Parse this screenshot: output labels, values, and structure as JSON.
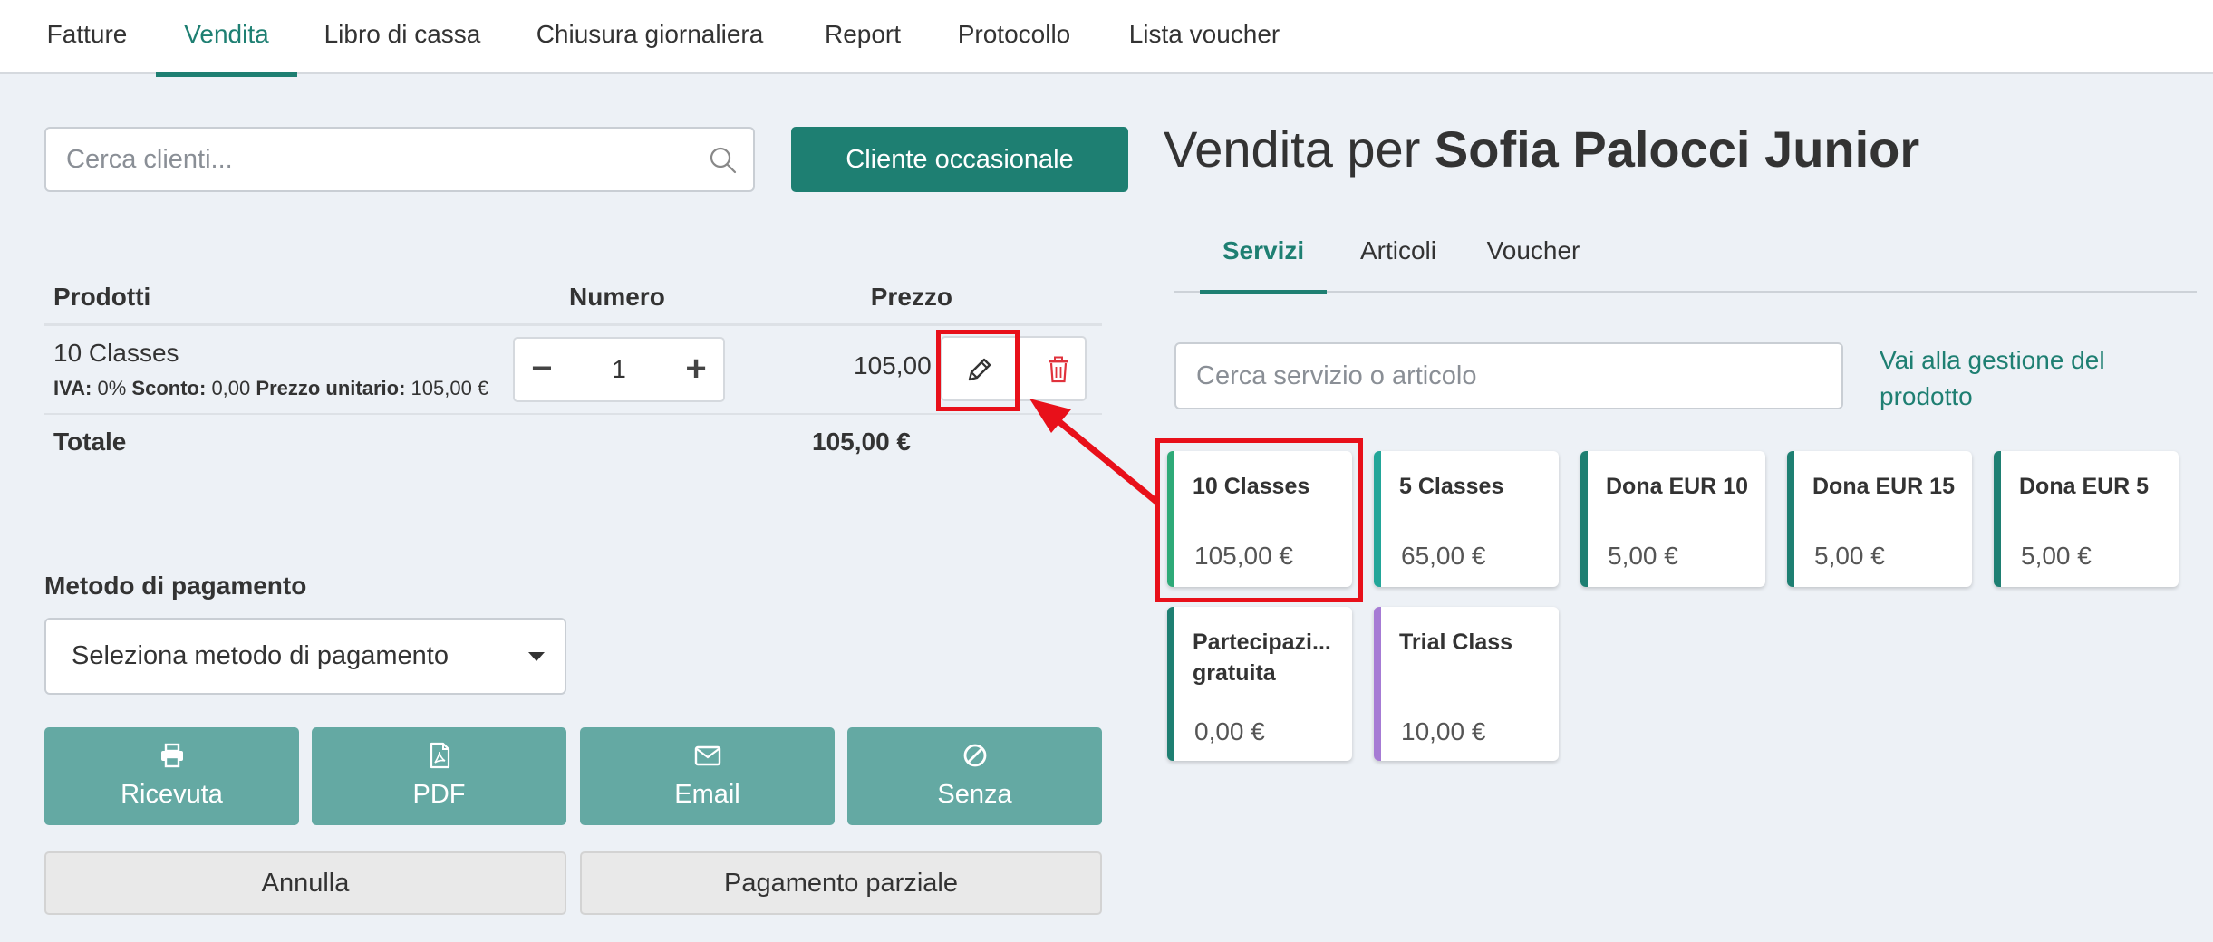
{
  "topnav": {
    "tabs": [
      {
        "label": "Fatture"
      },
      {
        "label": "Vendita"
      },
      {
        "label": "Libro di cassa"
      },
      {
        "label": "Chiusura giornaliera"
      },
      {
        "label": "Report"
      },
      {
        "label": "Protocollo"
      },
      {
        "label": "Lista voucher"
      }
    ],
    "active": "Vendita"
  },
  "client_search": {
    "placeholder": "Cerca clienti..."
  },
  "occasional_client_button": "Cliente occasionale",
  "products_table": {
    "headers": {
      "products": "Prodotti",
      "number": "Numero",
      "price": "Prezzo"
    },
    "rows": [
      {
        "name": "10 Classes",
        "vat_label": "IVA:",
        "vat": "0%",
        "discount_label": "Sconto:",
        "discount": "0,00",
        "unit_price_label": "Prezzo unitario:",
        "unit_price": "105,00 €",
        "quantity": "1",
        "price": "105,00 €"
      }
    ],
    "total_label": "Totale",
    "total_value": "105,00 €"
  },
  "payment": {
    "label": "Metodo di pagamento",
    "selected": "Seleziona metodo di pagamento",
    "actions": [
      {
        "label": "Ricevuta",
        "icon": "printer-icon"
      },
      {
        "label": "PDF",
        "icon": "pdf-file-icon"
      },
      {
        "label": "Email",
        "icon": "envelope-icon"
      },
      {
        "label": "Senza",
        "icon": "ban-icon"
      }
    ],
    "cancel": "Annulla",
    "partial": "Pagamento parziale"
  },
  "sale": {
    "prefix": "Vendita per",
    "customer": "Sofia Palocci Junior"
  },
  "catalog_tabs": [
    {
      "label": "Servizi"
    },
    {
      "label": "Articoli"
    },
    {
      "label": "Voucher"
    }
  ],
  "catalog_active": "Servizi",
  "service_search": {
    "placeholder": "Cerca servizio o articolo"
  },
  "product_management_link": "Vai alla gestione del prodotto",
  "services": [
    {
      "name": "10 Classes",
      "price": "105,00 €",
      "color": "#2eaa78"
    },
    {
      "name": "5 Classes",
      "price": "65,00 €",
      "color": "#22a699"
    },
    {
      "name": "Dona EUR 10",
      "price": "5,00 €",
      "color": "#1e7f72"
    },
    {
      "name": "Dona EUR 15",
      "price": "5,00 €",
      "color": "#1e7f72"
    },
    {
      "name": "Dona EUR 5",
      "price": "5,00 €",
      "color": "#1e7f72"
    },
    {
      "name": "Partecipazi... gratuita",
      "price": "0,00 €",
      "color": "#1e7f72"
    },
    {
      "name": "Trial Class",
      "price": "10,00 €",
      "color": "#a67bd4"
    }
  ],
  "colors": {
    "accent": "#1e7f72",
    "action_button": "#64a9a3",
    "highlight": "#e8101a",
    "delete": "#e0323c"
  }
}
